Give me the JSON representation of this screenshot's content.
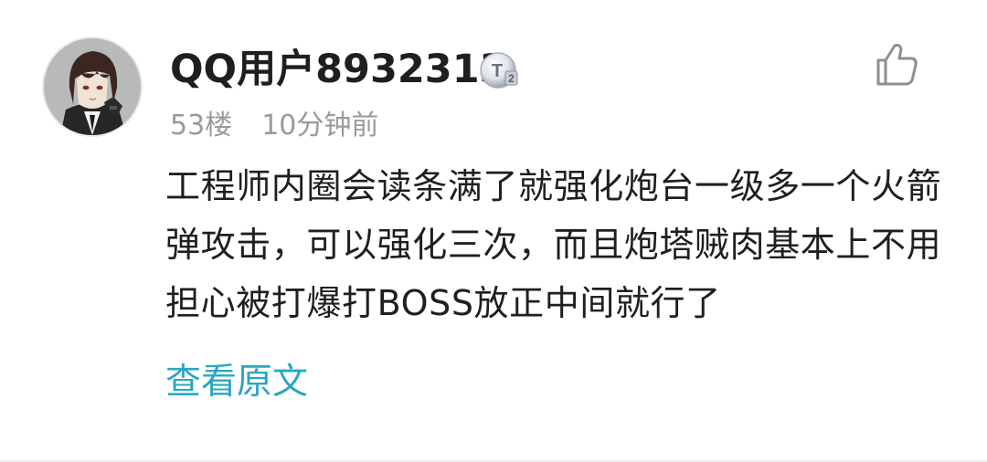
{
  "comment": {
    "username": "QQ用户8932313",
    "level_badge": "T2",
    "floor": "53楼",
    "time": "10分钟前",
    "content": "工程师内圈会读条满了就强化炮台一级多一个火箭弹攻击，可以强化三次，而且炮塔贼肉基本上不用担心被打爆打BOSS放正中间就行了",
    "view_original_label": "查看原文"
  },
  "icons": {
    "like": "thumbs-up-icon",
    "level": "level-badge-icon"
  },
  "colors": {
    "link": "#2aa7bf",
    "meta_text": "#9a9a9a",
    "body_text": "#1f1f1f"
  }
}
